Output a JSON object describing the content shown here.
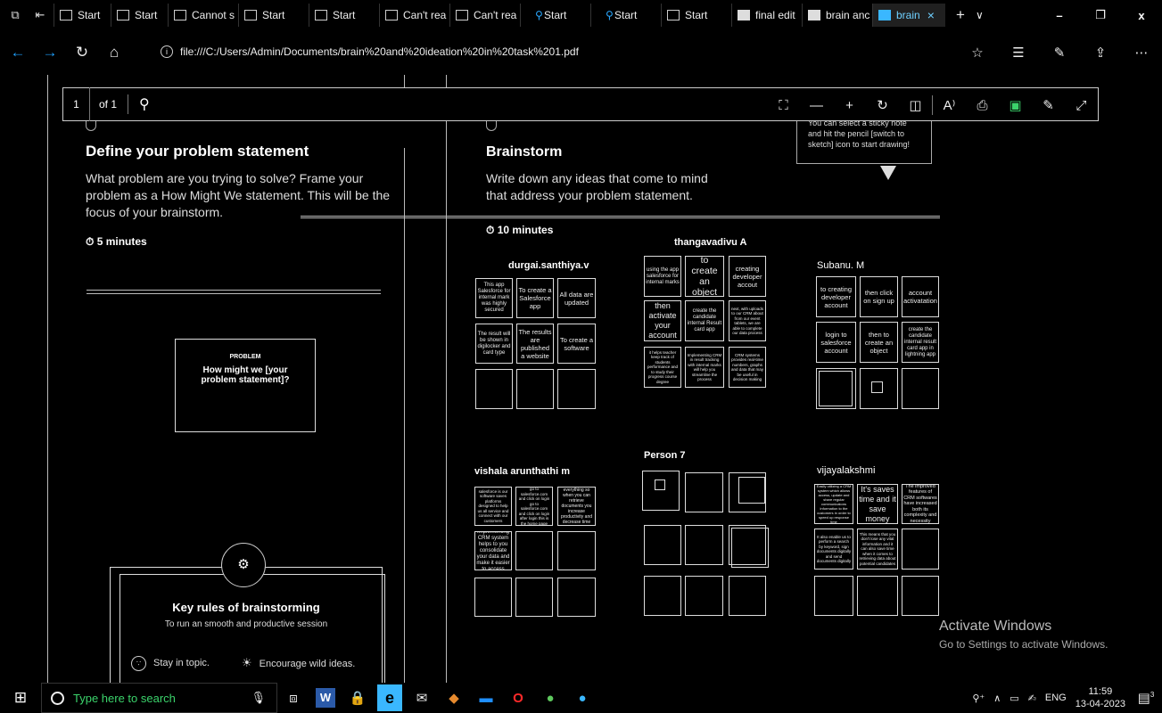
{
  "tabs": [
    {
      "label": "Start",
      "icon": "page-icon"
    },
    {
      "label": "Start",
      "icon": "page-icon"
    },
    {
      "label": "Cannot s",
      "icon": "window-icon"
    },
    {
      "label": "Start",
      "icon": "page-icon"
    },
    {
      "label": "Start",
      "icon": "page-icon"
    },
    {
      "label": "Can't rea",
      "icon": "window-icon"
    },
    {
      "label": "Can't rea",
      "icon": "window-icon"
    },
    {
      "label": "Start",
      "icon": "search-icon"
    },
    {
      "label": "Start",
      "icon": "search-icon"
    },
    {
      "label": "Start",
      "icon": "page-icon"
    },
    {
      "label": "final edit",
      "icon": "pdf-icon"
    },
    {
      "label": "brain anc",
      "icon": "pdf-icon"
    },
    {
      "label": "brain",
      "icon": "pdf-icon",
      "active": true
    }
  ],
  "address": {
    "url": "file:///C:/Users/Admin/Documents/brain%20and%20ideation%20in%20task%201.pdf"
  },
  "pdf_toolbar": {
    "page": "1",
    "of": "of 1"
  },
  "left_section": {
    "title": "Define your problem statement",
    "desc_lines": [
      "What problem are you trying to solve? Frame your",
      "problem as a How Might We statement. This will be the",
      "focus of your brainstorm."
    ],
    "time": "5 minutes",
    "problem_label": "PROBLEM",
    "problem_q1": "How might we [your",
    "problem_q2": "problem statement]?",
    "key_rules_title": "Key rules of brainstorming",
    "key_rules_sub": "To run an smooth and productive session",
    "rule1": "Stay in topic.",
    "rule2": "Encourage wild ideas."
  },
  "right_section": {
    "title": "Brainstorm",
    "desc_lines": [
      "Write down any ideas that come to mind",
      "that address your problem statement."
    ],
    "time": "10 minutes",
    "tip_lines": [
      "You can select a sticky note",
      "and hit the pencil [switch to",
      "sketch] icon to start drawing!"
    ]
  },
  "groups": {
    "durgai": {
      "name": "durgai.santhiya.v",
      "notes": [
        "This app Salesforce for internal mark was highly secured",
        "To create a Salesforce app",
        "All data are updated",
        "The result will be shown in digilocker and card type",
        "The results are published a website",
        "To create a software"
      ]
    },
    "thanga": {
      "name": "thangavadivu A",
      "notes": [
        "using the app salesforce for internal marks",
        "to create an object",
        "creating developer accout",
        "then activate your account",
        "create the candidate internal Result card app",
        "next, with uploads to our CRM about from our event tablets, we are able to complete our data process",
        "it helps teacher keep track of students performance and to study their progress course degree",
        "Implementing CRM in result tracking with internal marks will help you streamline the process",
        "CRM systems provides real-time numbers, graphs and data that may be useful in decision making"
      ]
    },
    "subanu": {
      "name": "Subanu. M",
      "notes": [
        "to creating developer account",
        "then click on sign up",
        "account activatation",
        "login to salesforce account",
        "then to create an object",
        "create the candidate internal result card app in lightning app"
      ]
    },
    "vishala": {
      "name": "vishala arunthathi m",
      "notes": [
        "salesforce is our software saves platforms designed to help us all service and connect with our customers",
        "go to salesforce.com and click on login go to salesforce.com and click on login after login this is the home page",
        "Time is everything so when you can retrieve documents you increase productivity and decrease time waste",
        "Implementing CRM system helps to you consolidate your data and make it easier to access"
      ]
    },
    "person7": {
      "name": "Person 7"
    },
    "vijaya": {
      "name": "vijayalakshmi",
      "notes": [
        "Easily utilizing a CRM system which allows access, update and share regular communicatons information to the customers in order to speed up response time",
        "It's saves time and it save money",
        "The improved features of CRM softwares have increased both its complexity and necessity",
        "It also enable us to perform a search by keyword, sign documents digitally and send documents digitally",
        "This means that you don't lose any vital information and it can also save time when it comes to retrieving data about potential candidates"
      ]
    }
  },
  "watermark": {
    "title": "Activate Windows",
    "sub": "Go to Settings to activate Windows."
  },
  "taskbar": {
    "search_placeholder": "Type here to search",
    "lang": "ENG",
    "time": "11:59",
    "date": "13-04-2023",
    "notif_count": "3"
  }
}
